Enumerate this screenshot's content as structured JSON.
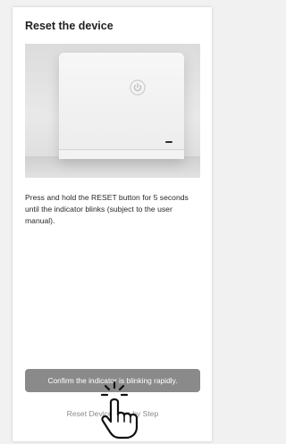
{
  "screen": {
    "title": "Reset the device",
    "instruction": "Press and hold the RESET button for 5 seconds until the indicator blinks (subject to the user manual).",
    "confirm_button_label": "Confirm the indicator is blinking rapidly.",
    "step_link_label": "Reset Device Step by Step"
  },
  "colors": {
    "background": "#f1f1f1",
    "card": "#ffffff",
    "button": "#8a8a8a",
    "link": "#8a8a8a"
  },
  "icons": {
    "power": "power-icon",
    "pointer": "hand-pointer-icon"
  }
}
